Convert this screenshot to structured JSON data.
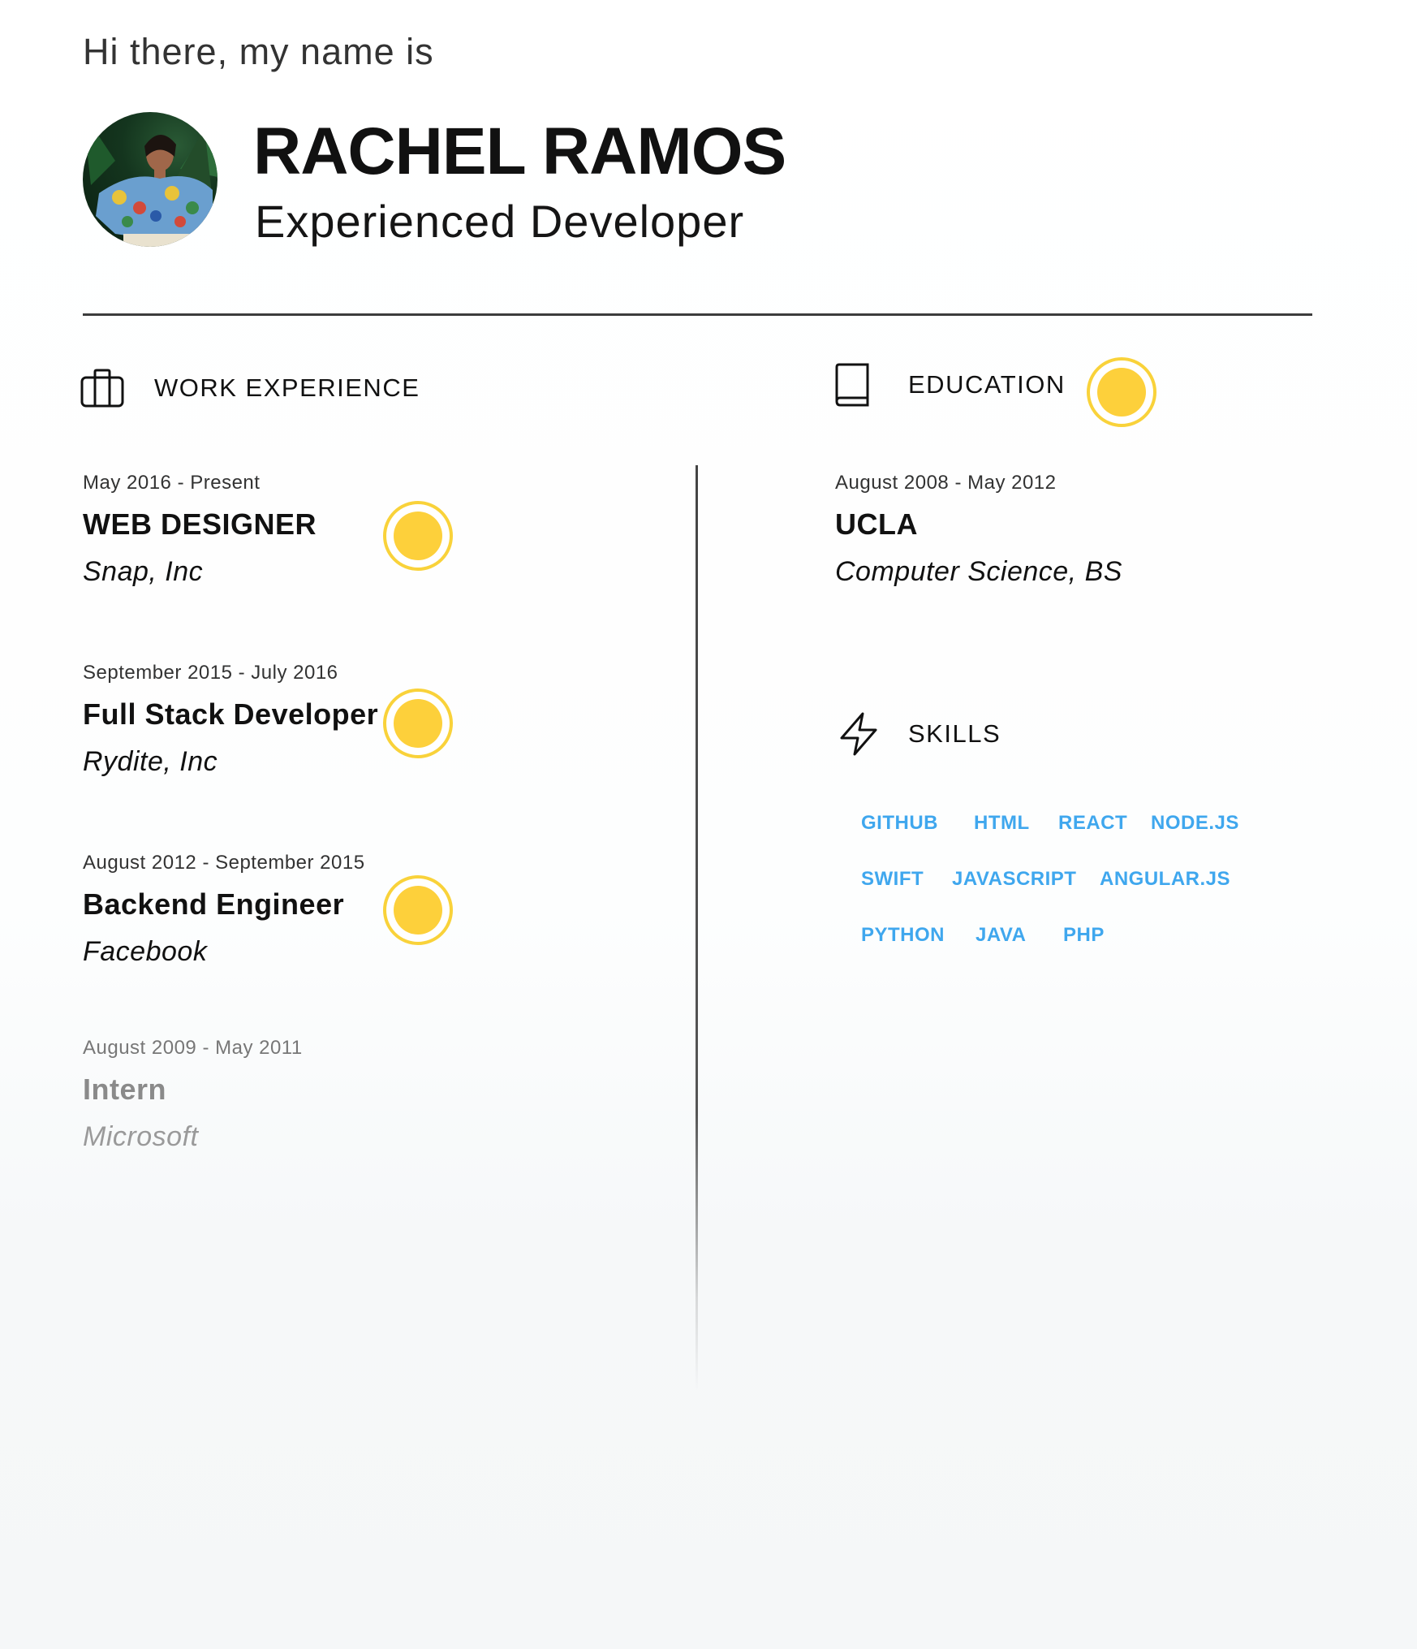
{
  "header": {
    "greeting": "Hi there, my name is",
    "name": "RACHEL RAMOS",
    "role": "Experienced Developer"
  },
  "sections": {
    "work": {
      "label": "WORK EXPERIENCE",
      "icon": "briefcase-icon"
    },
    "education": {
      "label": "EDUCATION",
      "icon": "book-icon"
    },
    "skills": {
      "label": "SKILLS",
      "icon": "lightning-icon"
    }
  },
  "work": [
    {
      "date": "May 2016 - Present",
      "title": "WEB DESIGNER",
      "org": "Snap, Inc"
    },
    {
      "date": "September  2015 - July 2016",
      "title": "Full Stack Developer",
      "org": "Rydite, Inc"
    },
    {
      "date": "August  2012 -  September 2015",
      "title": "Backend Engineer",
      "org": "Facebook"
    },
    {
      "date": "August  2009 -  May 2011",
      "title": "Intern",
      "org": "Microsoft"
    }
  ],
  "education": [
    {
      "date": "August 2008 - May 2012",
      "school": "UCLA",
      "degree": "Computer Science, BS"
    }
  ],
  "skills": [
    [
      "GITHUB",
      "HTML",
      "REACT",
      "NODE.JS"
    ],
    [
      "SWIFT",
      "JAVASCRIPT",
      "ANGULAR.JS"
    ],
    [
      "PYTHON",
      "JAVA",
      "PHP"
    ]
  ],
  "colors": {
    "accent_dot": "#fdd03b",
    "skill_text": "#3fa7ee",
    "rule": "#3c3c3c"
  }
}
